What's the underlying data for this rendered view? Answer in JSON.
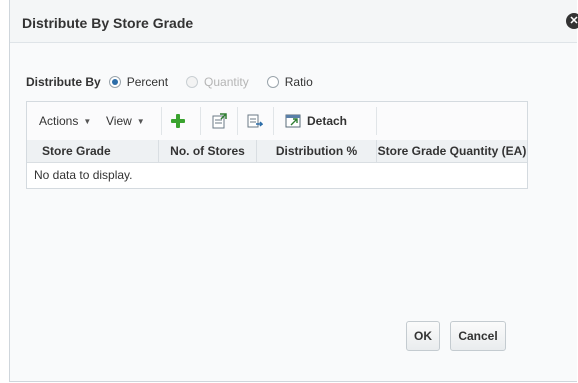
{
  "dialog": {
    "title": "Distribute By Store Grade",
    "close_icon": "close-icon"
  },
  "distribute": {
    "label": "Distribute By",
    "options": [
      {
        "label": "Percent",
        "checked": true,
        "disabled": false
      },
      {
        "label": "Quantity",
        "checked": false,
        "disabled": true
      },
      {
        "label": "Ratio",
        "checked": false,
        "disabled": false
      }
    ]
  },
  "toolbar": {
    "actions_label": "Actions",
    "view_label": "View",
    "detach_label": "Detach",
    "icons": [
      "add-icon",
      "export-icon",
      "edit-icon",
      "detach-icon"
    ]
  },
  "table": {
    "columns": [
      "Store Grade",
      "No. of Stores",
      "Distribution %",
      "Store Grade Quantity (EA)"
    ],
    "rows": [],
    "empty_text": "No data to display."
  },
  "footer": {
    "ok_label": "OK",
    "cancel_label": "Cancel"
  },
  "colors": {
    "accent": "#2c6da8",
    "add_icon": "#3aa32f"
  }
}
